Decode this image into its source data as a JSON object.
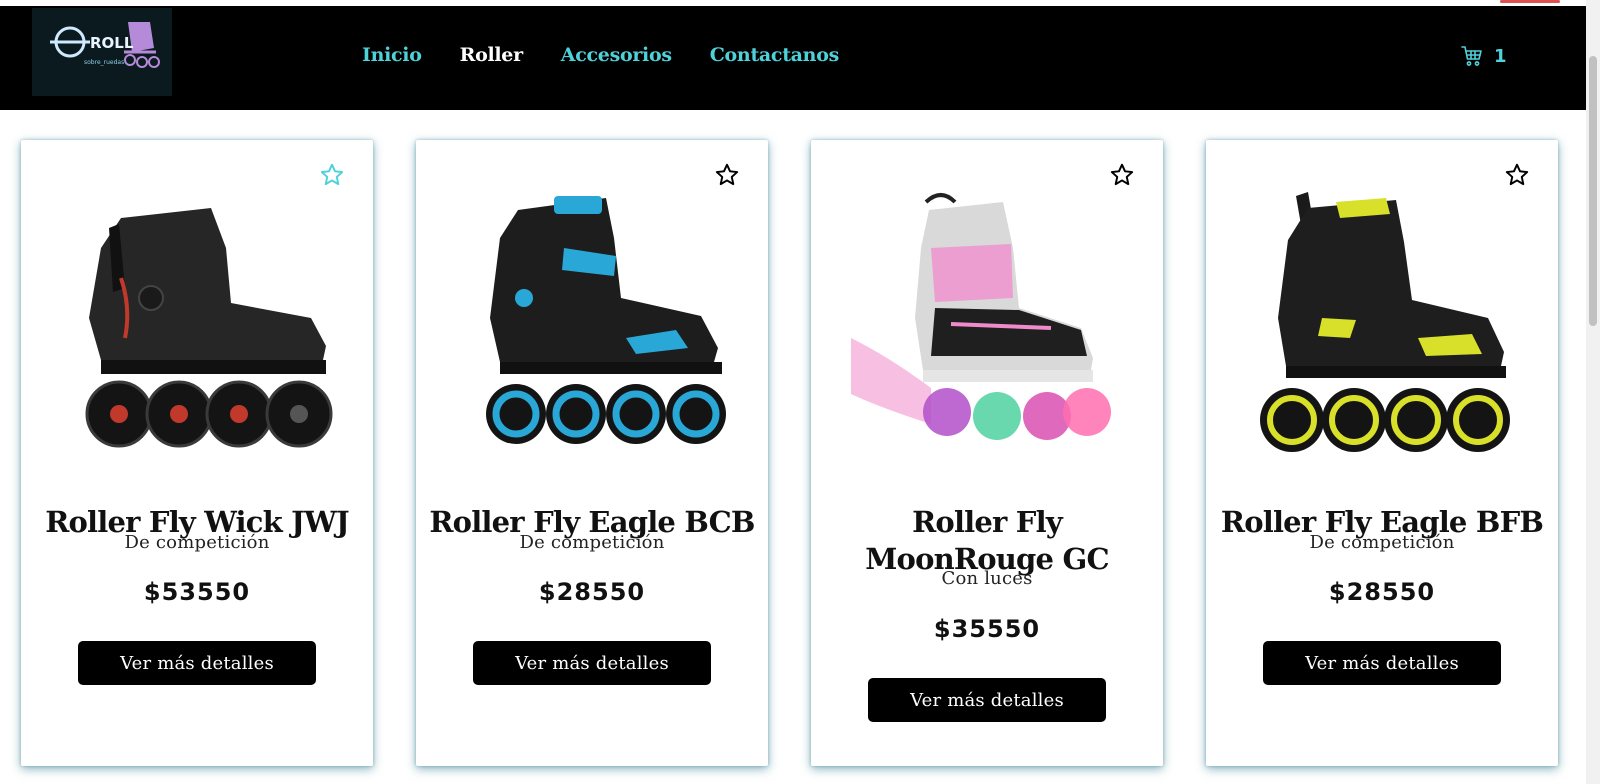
{
  "brand": {
    "logo_text": "ROLL",
    "logo_subtext": "sobre_ruedas"
  },
  "nav": {
    "items": [
      {
        "label": "Inicio",
        "active": false
      },
      {
        "label": "Roller",
        "active": true
      },
      {
        "label": "Accesorios",
        "active": false
      },
      {
        "label": "Contactanos",
        "active": false
      }
    ]
  },
  "cart": {
    "icon": "cart-icon",
    "count": "1"
  },
  "colors": {
    "accent": "#4fd1d9",
    "navbar": "#000000",
    "button": "#000000"
  },
  "products": [
    {
      "title": "Roller Fly Wick JWJ",
      "subtitle": "De competición",
      "price": "$53550",
      "button_label": "Ver más detalles",
      "favorite": true,
      "accent": "#c0392b"
    },
    {
      "title": "Roller Fly Eagle BCB",
      "subtitle": "De competición",
      "price": "$28550",
      "button_label": "Ver más detalles",
      "favorite": false,
      "accent": "#29a8d8"
    },
    {
      "title": "Roller Fly MoonRouge GC",
      "subtitle": "Con luces",
      "price": "$35550",
      "button_label": "Ver más detalles",
      "favorite": false,
      "accent": "#f08acb"
    },
    {
      "title": "Roller Fly Eagle BFB",
      "subtitle": "De competición",
      "price": "$28550",
      "button_label": "Ver más detalles",
      "favorite": false,
      "accent": "#d8e02a"
    }
  ]
}
